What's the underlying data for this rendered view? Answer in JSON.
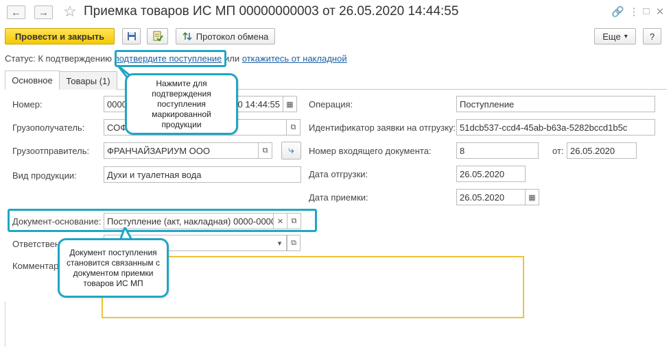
{
  "window": {
    "title": "Приемка товаров ИС МП 00000000003 от 26.05.2020 14:44:55",
    "back_icon": "arrow-left",
    "forward_icon": "arrow-right",
    "star_icon": "star",
    "link_icon": "link",
    "menu_icon": "vertical-dots",
    "maximize_icon": "square",
    "close_icon": "x"
  },
  "toolbar": {
    "post_close_label": "Провести и закрыть",
    "save_icon": "floppy",
    "post_icon": "document-check",
    "exchange_label": "Протокол обмена",
    "more_label": "Еще",
    "more_arrow": "▾",
    "help_label": "?"
  },
  "status": {
    "prefix": "Статус:  К подтверждению",
    "confirm_link": "подтвердите поступление",
    "or_text": "или",
    "reject_link": "откажитесь от накладной"
  },
  "tabs": [
    {
      "label": "Основное",
      "active": true
    },
    {
      "label": "Товары (1)",
      "active": false
    }
  ],
  "form": {
    "number_label": "Номер:",
    "number_value": "0000",
    "date_value": "0 14:44:55",
    "consignee_label": "Грузополучатель:",
    "consignee_value": "СОФ",
    "shipper_label": "Грузоотправитель:",
    "shipper_value": "ФРАНЧАЙЗАРИУМ ООО",
    "product_type_label": "Вид продукции:",
    "product_type_value": "Духи и туалетная вода",
    "operation_label": "Операция:",
    "operation_value": "Поступление",
    "request_id_label": "Идентификатор заявки на отгрузку:",
    "request_id_value": "51dcb537-ccd4-45ab-b63a-5282bccd1b5c",
    "incoming_doc_label": "Номер входящего документа:",
    "incoming_doc_value": "8",
    "from_label": "от:",
    "from_value": "26.05.2020",
    "shipment_date_label": "Дата отгрузки:",
    "shipment_date_value": "26.05.2020",
    "acceptance_date_label": "Дата приемки:",
    "acceptance_date_value": "26.05.2020",
    "basis_doc_label": "Документ-основание:",
    "basis_doc_value": "Поступление (акт, накладная) 0000-0000",
    "responsible_label": "Ответственн",
    "responsible_value": "",
    "comment_label": "Комментар",
    "comment_value": ""
  },
  "callouts": {
    "top": "Нажмите для подтверждения поступления маркированной продукции",
    "bottom": "Документ поступления становится связанным с документом приемки товаров ИС МП"
  },
  "colors": {
    "accent": "#1fa6c4",
    "primary_button": "#f5c900",
    "link": "#1b5fa1",
    "comment_border": "#f0c23a"
  }
}
